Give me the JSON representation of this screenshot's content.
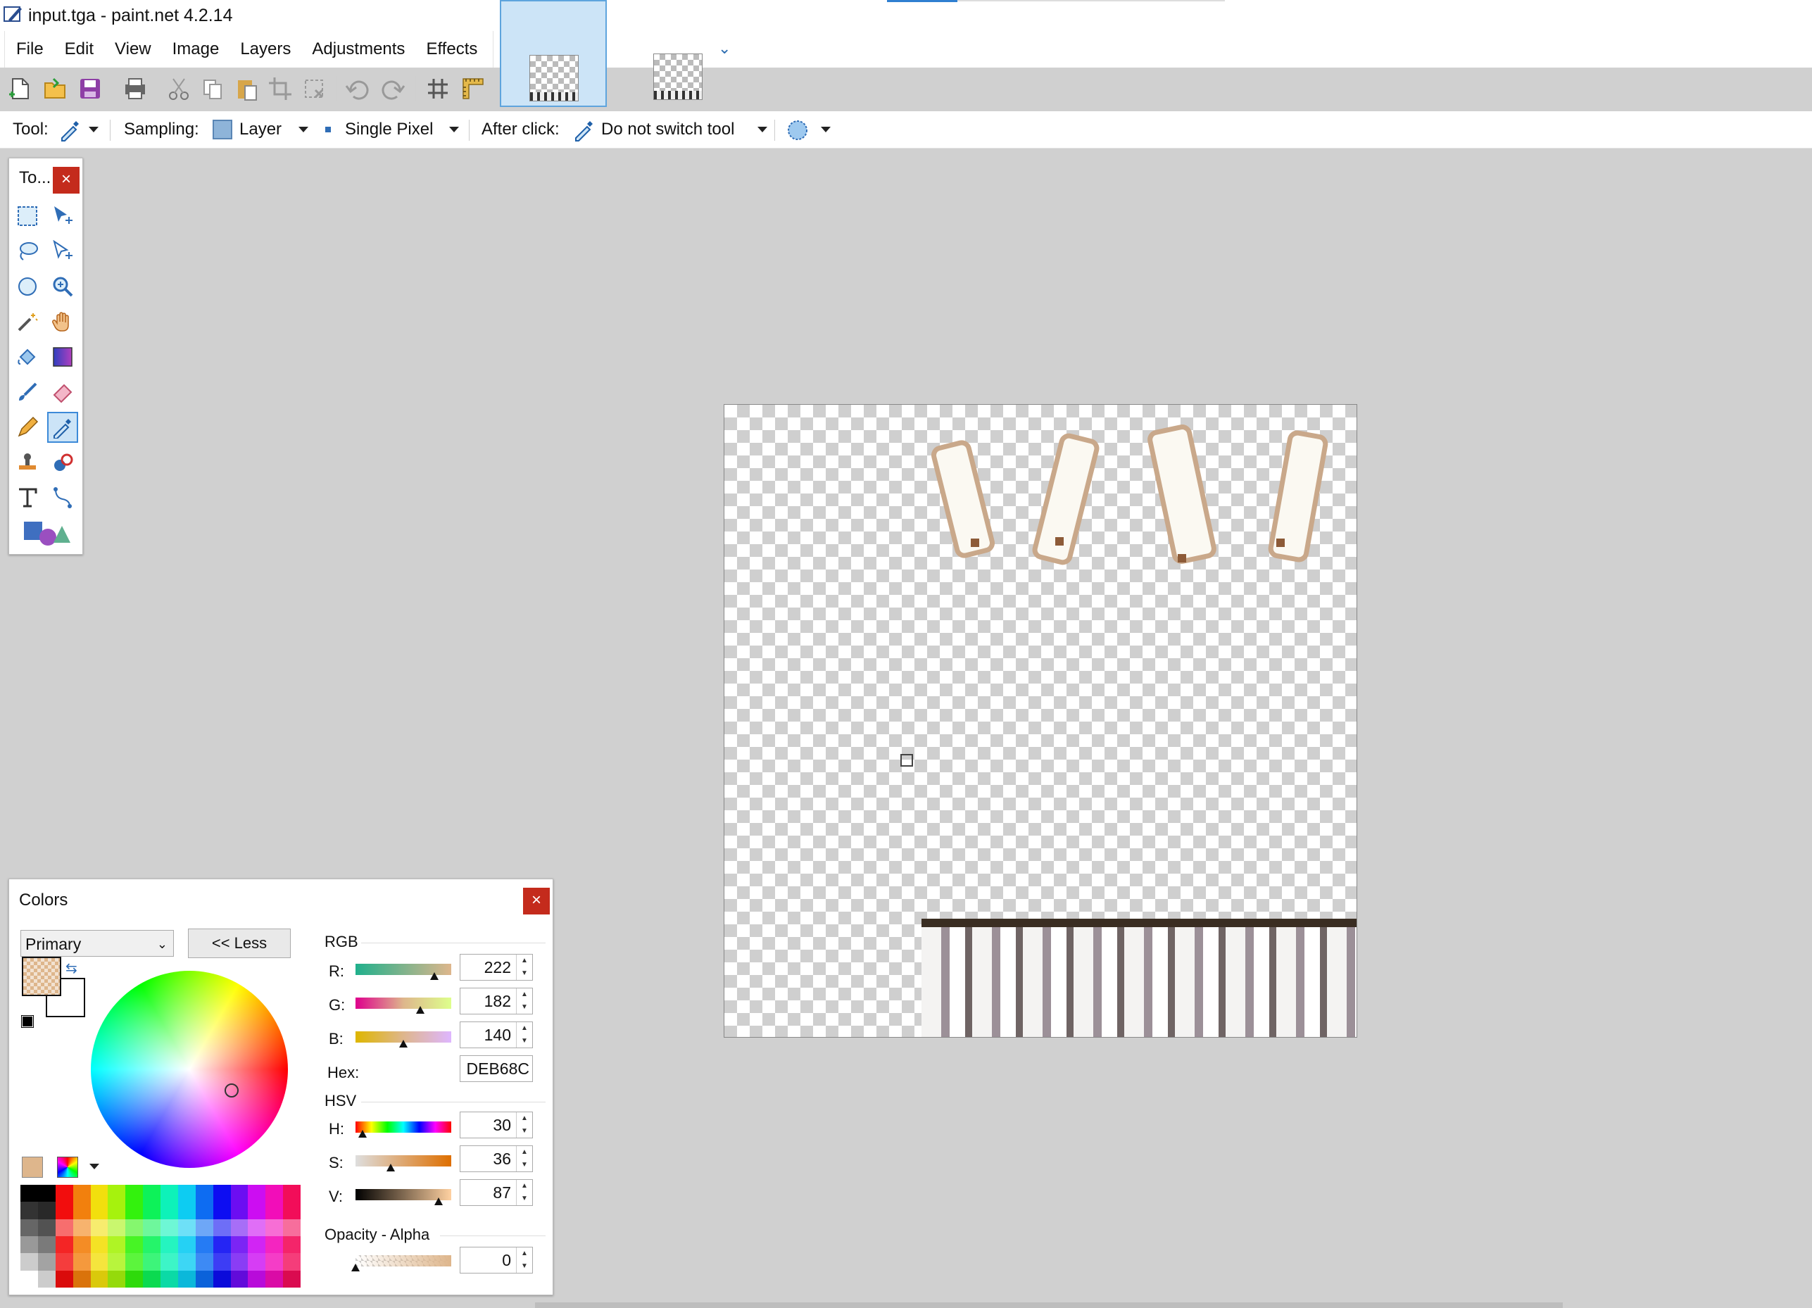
{
  "window": {
    "title": "input.tga - paint.net 4.2.14"
  },
  "menu": [
    "File",
    "Edit",
    "View",
    "Image",
    "Layers",
    "Adjustments",
    "Effects"
  ],
  "toolbar_icons": [
    "new-icon",
    "open-icon",
    "save-icon",
    "print-icon",
    "cut-icon",
    "copy-icon",
    "paste-icon",
    "crop-icon",
    "deselect-icon",
    "undo-icon",
    "redo-icon",
    "grid-icon",
    "ruler-icon"
  ],
  "options": {
    "tool_label": "Tool:",
    "sampling_label": "Sampling:",
    "sampling_value": "Layer",
    "pixel_value": "Single Pixel",
    "after_click_label": "After click:",
    "after_click_value": "Do not switch tool"
  },
  "tools_panel": {
    "title": "To...",
    "close": "×",
    "selected_tool": "color-picker"
  },
  "colors": {
    "title": "Colors",
    "close": "×",
    "target": "Primary",
    "less_button": "<< Less",
    "rgb_label": "RGB",
    "r_label": "R:",
    "g_label": "G:",
    "b_label": "B:",
    "r": "222",
    "g": "182",
    "b": "140",
    "hex_label": "Hex:",
    "hex": "DEB68C",
    "hsv_label": "HSV",
    "h_label": "H:",
    "s_label": "S:",
    "v_label": "V:",
    "h": "30",
    "s": "36",
    "v": "87",
    "opacity_label": "Opacity - Alpha",
    "alpha": "0",
    "primary_color": "#DEB68C",
    "secondary_color": "#FFFFFF"
  }
}
